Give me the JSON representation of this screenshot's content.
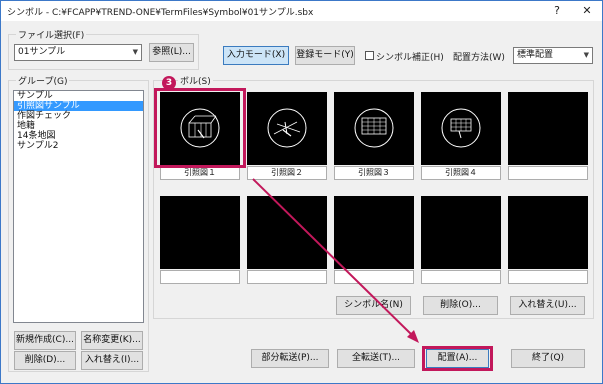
{
  "window": {
    "title": "シンボル - C:¥FCAPP¥TREND-ONE¥TermFiles¥Symbol¥01サンプル.sbx",
    "help": "?",
    "close": "✕"
  },
  "file_select": {
    "label": "ファイル選択(F)",
    "value": "01サンプル",
    "browse_label": "参照(L)..."
  },
  "mode": {
    "input_mode": "入力モード(X)",
    "register_mode": "登録モード(Y)",
    "correction_label": "シンボル補正(H)",
    "correction_checked": false,
    "placement_label": "配置方法(W)",
    "placement_value": "標準配置"
  },
  "group": {
    "label": "グループ(G)",
    "items": [
      "サンプル",
      "引照図サンプル",
      "作図チェック",
      "地籍",
      "14条地図",
      "サンプル2"
    ],
    "selected_index": 1,
    "new_label": "新規作成(C)...",
    "rename_label": "名称変更(K)...",
    "delete_label": "削除(D)...",
    "swap_label": "入れ替え(I)..."
  },
  "symbols": {
    "label": "ボル(S)",
    "step_badge": "3",
    "items": [
      "引照図１",
      "引照図２",
      "引照図３",
      "引照図４",
      "",
      "",
      "",
      "",
      "",
      ""
    ],
    "symbol_name_label": "シンボル名(N)",
    "delete_label": "削除(O)...",
    "swap_label": "入れ替え(U)..."
  },
  "footer": {
    "partial_transfer": "部分転送(P)...",
    "full_transfer": "全転送(T)...",
    "place": "配置(A)...",
    "finish": "終了(Q)"
  },
  "colors": {
    "annotation": "#c2185b",
    "selection": "#3399ff",
    "pressed": "#cce4f7"
  }
}
